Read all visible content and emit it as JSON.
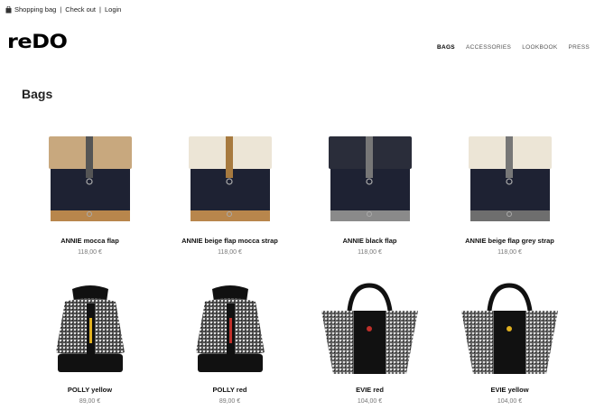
{
  "topbar": {
    "shopping_bag": "Shopping bag",
    "separator1": "|",
    "checkout": "Check out",
    "separator2": "|",
    "login": "Login"
  },
  "logo": "reDO",
  "nav": {
    "bags": "BAGS",
    "accessories": "ACCESSORIES",
    "lookbook": "LOOKBOOK",
    "press": "PRESS"
  },
  "page_title": "Bags",
  "products": [
    {
      "name": "ANNIE mocca flap",
      "price": "118,00 €",
      "flap": "#c8a87e",
      "bottom": "#b8864c"
    },
    {
      "name": "ANNIE beige flap mocca strap",
      "price": "118,00 €",
      "flap": "#ece5d6",
      "bottom": "#b8864c"
    },
    {
      "name": "ANNIE black flap",
      "price": "118,00 €",
      "flap": "#2a2d3a",
      "bottom": "#8a8a8a"
    },
    {
      "name": "ANNIE beige flap grey strap",
      "price": "118,00 €",
      "flap": "#ece5d6",
      "bottom": "#6e6e6e"
    },
    {
      "name": "POLLY yellow",
      "price": "89,00 €",
      "accent": "#e0b020"
    },
    {
      "name": "POLLY red",
      "price": "89,00 €",
      "accent": "#c0302a"
    },
    {
      "name": "EVIE red",
      "price": "104,00 €",
      "accent": "#c0302a"
    },
    {
      "name": "EVIE yellow",
      "price": "104,00 €",
      "accent": "#e0b020"
    }
  ]
}
